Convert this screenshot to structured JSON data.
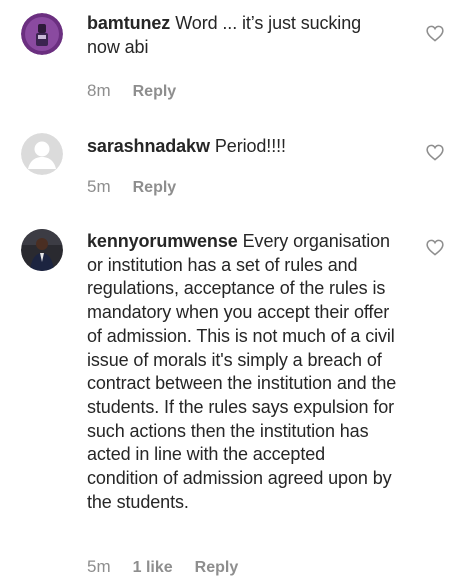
{
  "comments": [
    {
      "username": "bamtunez",
      "text": "Word ... it’s just sucking now abi",
      "time": "8m",
      "likes": "",
      "reply_label": "Reply",
      "like_icon": "heart-outline-icon"
    },
    {
      "username": "sarashnadakw",
      "text": "Period!!!!",
      "time": "5m",
      "likes": "",
      "reply_label": "Reply",
      "like_icon": "heart-outline-icon"
    },
    {
      "username": "kennyorumwense",
      "text": "Every organisation or institution has a set of rules and regulations, acceptance of the rules is mandatory when you accept their offer of admission. This is not much of a civil issue of morals it's simply a breach of contract between the institution and the students. If the rules says expulsion for such actions then the institution has acted in line with the accepted condition of admission agreed upon by the students.",
      "time": "5m",
      "likes": "1 like",
      "reply_label": "Reply",
      "like_icon": "heart-outline-icon"
    }
  ],
  "colors": {
    "text": "#262626",
    "meta": "#8e8e8e",
    "default_avatar_bg": "#dbdbdb",
    "avatar_1_bg": "#7b3f8c"
  }
}
